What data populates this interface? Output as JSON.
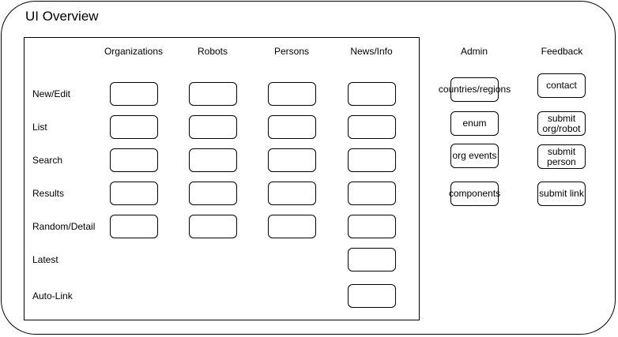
{
  "title": "UI Overview",
  "columns": [
    "Organizations",
    "Robots",
    "Persons",
    "News/Info"
  ],
  "rows": [
    "New/Edit",
    "List",
    "Search",
    "Results",
    "Random/Detail",
    "Latest",
    "Auto-Link"
  ],
  "admin": {
    "heading": "Admin",
    "items": [
      "countries/regions",
      "enum",
      "org events",
      "components"
    ]
  },
  "feedback": {
    "heading": "Feedback",
    "items": [
      "contact",
      "submit\norg/robot",
      "submit\nperson",
      "submit link"
    ]
  }
}
